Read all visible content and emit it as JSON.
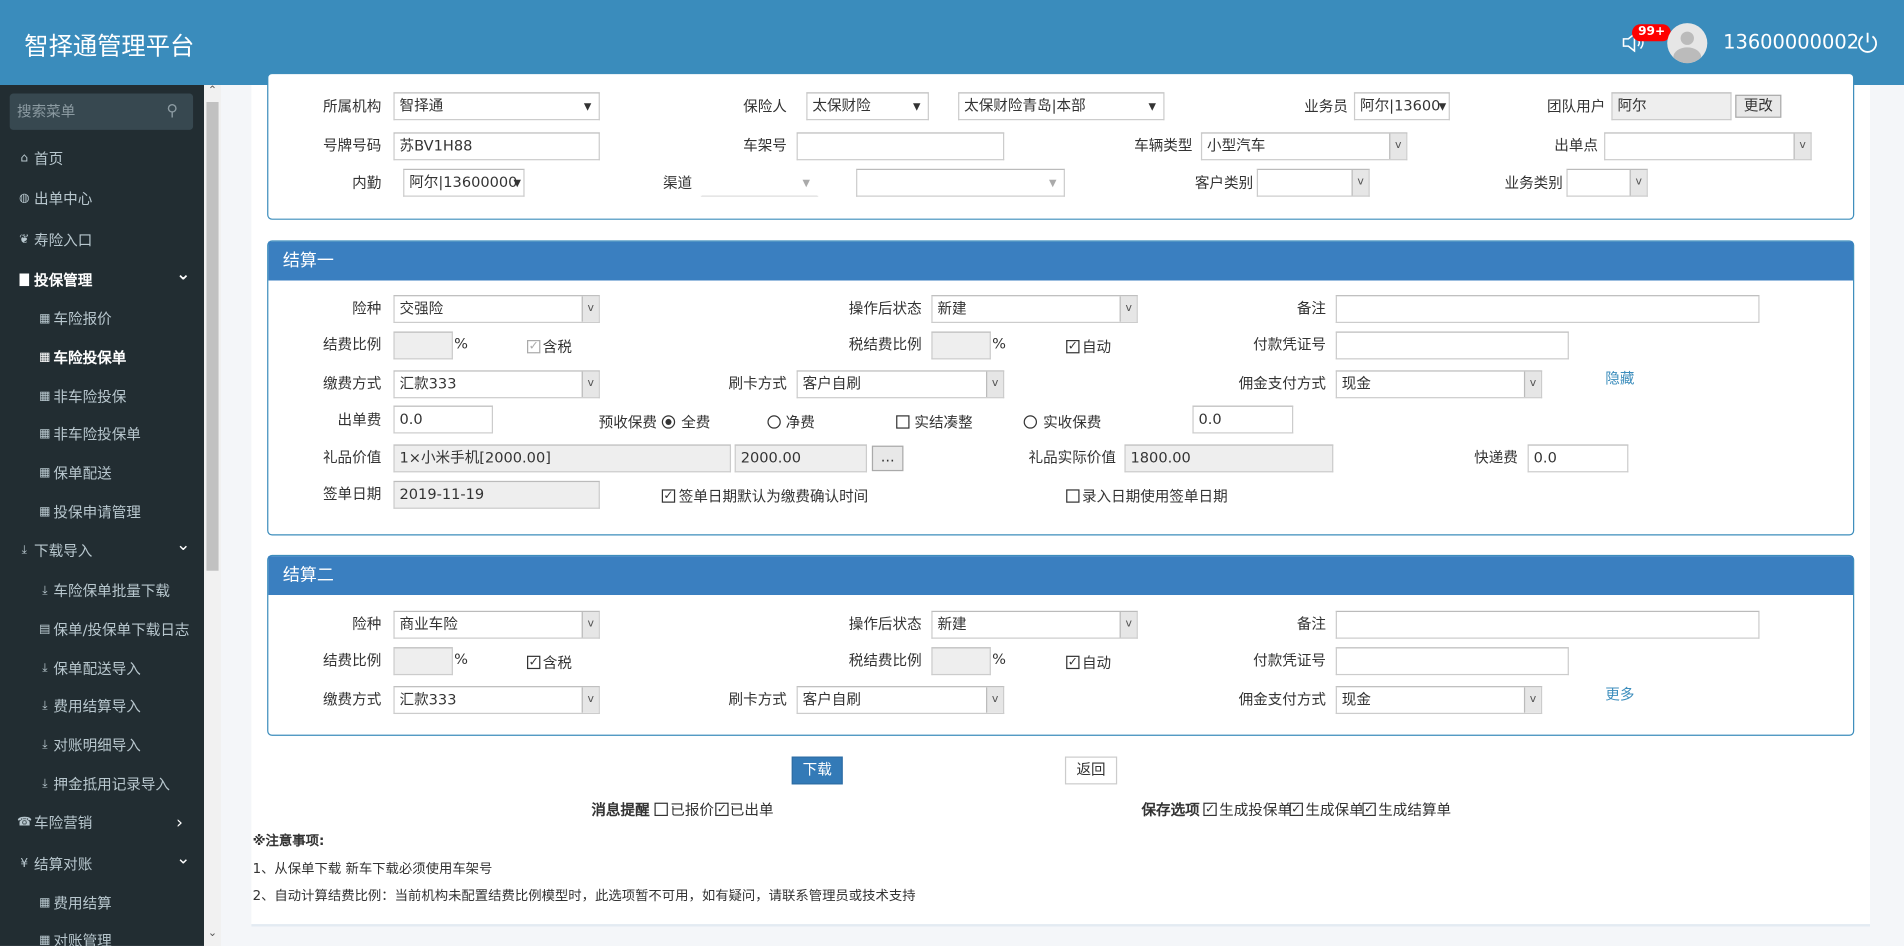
{
  "header": {
    "title": "智择通管理平台",
    "badge": "99+",
    "phone": "13600000002",
    "icons": [
      "speaker-icon",
      "avatar",
      "power-icon"
    ],
    "color": "#3a8cbc"
  },
  "sidebar": {
    "search_placeholder": "搜索菜单",
    "items": [
      {
        "label": "首页",
        "icon": "home-icon"
      },
      {
        "label": "出单中心",
        "icon": "globe-icon"
      },
      {
        "label": "寿险入口",
        "icon": "leaf-icon"
      },
      {
        "label": "投保管理",
        "icon": "file-icon"
      },
      {
        "label": "车险报价",
        "icon": "grid-icon"
      },
      {
        "label": "车险投保单",
        "icon": "grid-icon"
      },
      {
        "label": "非车险投保",
        "icon": "grid-icon"
      },
      {
        "label": "非车险投保单",
        "icon": "grid-icon"
      },
      {
        "label": "保单配送",
        "icon": "grid-icon"
      },
      {
        "label": "投保申请管理",
        "icon": "grid-icon"
      },
      {
        "label": "下载导入",
        "icon": "import-icon"
      },
      {
        "label": "车险保单批量下载",
        "icon": "download-icon"
      },
      {
        "label": "保单/投保单下载日志",
        "icon": "list-icon"
      },
      {
        "label": "保单配送导入",
        "icon": "import-icon"
      },
      {
        "label": "费用结算导入",
        "icon": "import-icon"
      },
      {
        "label": "对账明细导入",
        "icon": "import-icon"
      },
      {
        "label": "押金抵用记录导入",
        "icon": "import-icon"
      },
      {
        "label": "车险营销",
        "icon": "phone-icon"
      },
      {
        "label": "结算对账",
        "icon": "yen-icon"
      },
      {
        "label": "费用结算",
        "icon": "grid-icon"
      },
      {
        "label": "对账管理",
        "icon": "grid-icon"
      }
    ]
  },
  "basic": {
    "org_label": "所属机构",
    "org_value": "智择通",
    "insurer_label": "保险人",
    "insurer_value": "太保财险",
    "branch_value": "太保财险青岛|本部",
    "salesman_label": "业务员",
    "salesman_value": "阿尔|13600",
    "team_label": "团队用户",
    "team_value": "阿尔",
    "change_button": "更改",
    "plate_label": "号牌号码",
    "plate_value": "苏BV1H88",
    "vin_label": "车架号",
    "vin_value": "",
    "vehicle_type_label": "车辆类型",
    "vehicle_type_value": "小型汽车",
    "outlet_label": "出单点",
    "outlet_value": "",
    "staff_label": "内勤",
    "staff_value": "阿尔|13600000",
    "channel_label": "渠道",
    "channel_value": "",
    "channel2_value": "",
    "customer_type_label": "客户类别",
    "customer_type_value": "",
    "biz_type_label": "业务类别",
    "biz_type_value": ""
  },
  "settle1": {
    "title": "结算一",
    "type_label": "险种",
    "type_value": "交强险",
    "status_label": "操作后状态",
    "status_value": "新建",
    "remark_label": "备注",
    "remark_value": "",
    "ratio_label": "结费比例",
    "ratio_value": "",
    "percent": "%",
    "tax_label": "含税",
    "tax_checked": true,
    "tax_ratio_label": "税结费比例",
    "tax_ratio_value": "",
    "auto_label": "自动",
    "auto_checked": true,
    "voucher_label": "付款凭证号",
    "voucher_value": "",
    "pay_label": "缴费方式",
    "pay_value": "汇款333",
    "card_label": "刷卡方式",
    "card_value": "客户自刷",
    "commission_label": "佣金支付方式",
    "commission_value": "现金",
    "toggle_link": "隐藏",
    "fee_label": "出单费",
    "fee_value": "0.0",
    "premium_label": "预收保费",
    "radio_full": "全费",
    "radio_net": "净费",
    "round_label": "实结凑整",
    "radio_actual": "实收保费",
    "premium_selected": "全费",
    "premium_value": "0.0",
    "gift_label": "礼品价值",
    "gift_value": "1×小米手机[2000.00]",
    "gift_amount": "2000.00",
    "gift_button": "...",
    "gift_real_label": "礼品实际价值",
    "gift_real_value": "1800.00",
    "express_label": "快递费",
    "express_value": "0.0",
    "sign_label": "签单日期",
    "sign_value": "2019-11-19",
    "sign_default_label": "签单日期默认为缴费确认时间",
    "sign_default_checked": true,
    "entry_label": "录入日期使用签单日期",
    "entry_checked": false
  },
  "settle2": {
    "title": "结算二",
    "type_label": "险种",
    "type_value": "商业车险",
    "status_label": "操作后状态",
    "status_value": "新建",
    "remark_label": "备注",
    "remark_value": "",
    "ratio_label": "结费比例",
    "ratio_value": "",
    "percent": "%",
    "tax_label": "含税",
    "tax_checked": true,
    "tax_ratio_label": "税结费比例",
    "tax_ratio_value": "",
    "auto_label": "自动",
    "auto_checked": true,
    "voucher_label": "付款凭证号",
    "voucher_value": "",
    "pay_label": "缴费方式",
    "pay_value": "汇款333",
    "card_label": "刷卡方式",
    "card_value": "客户自刷",
    "commission_label": "佣金支付方式",
    "commission_value": "现金",
    "toggle_link": "更多"
  },
  "actions": {
    "download": "下载",
    "back": "返回",
    "primary_color": "#337ab7"
  },
  "options": {
    "notify_label": "消息提醒",
    "quoted": "已报价",
    "quoted_checked": false,
    "issued": "已出单",
    "issued_checked": true,
    "save_label": "保存选项",
    "gen_proposal": "生成投保单",
    "gen_policy": "生成保单",
    "gen_settle": "生成结算单"
  },
  "notes": {
    "title": "※注意事项:",
    "line1": "1、从保单下载 新车下载必须使用车架号",
    "line2": "2、自动计算结费比例：当前机构未配置结费比例模型时，此选项暂不可用，如有疑问，请联系管理员或技术支持"
  }
}
